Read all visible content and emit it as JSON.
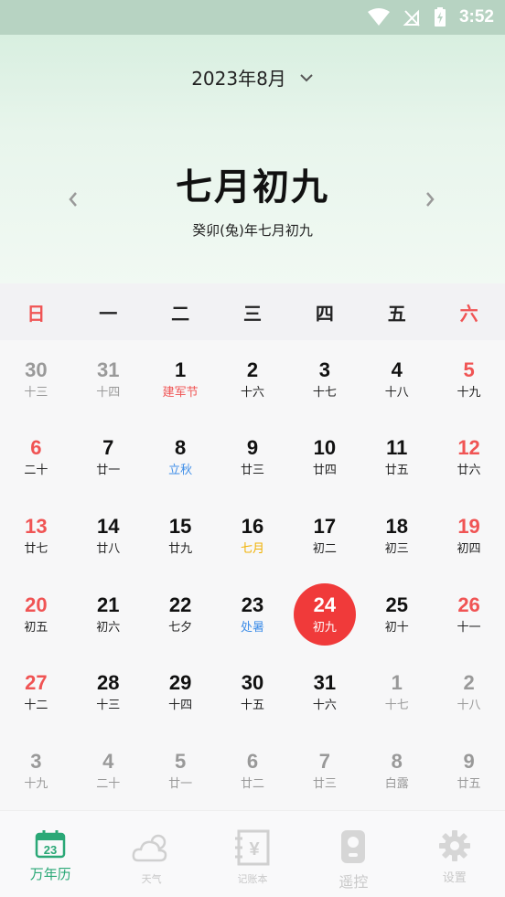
{
  "status_bar": {
    "time": "3:52"
  },
  "header": {
    "month_label": "2023年8月",
    "lunar_date": "七月初九",
    "lunar_full": "癸卯(兔)年七月初九"
  },
  "weekdays": [
    "日",
    "一",
    "二",
    "三",
    "四",
    "五",
    "六"
  ],
  "calendar": {
    "days": [
      {
        "num": "30",
        "sub": "十三",
        "other": true
      },
      {
        "num": "31",
        "sub": "十四",
        "other": true
      },
      {
        "num": "1",
        "sub": "建军节",
        "tag": "red"
      },
      {
        "num": "2",
        "sub": "十六"
      },
      {
        "num": "3",
        "sub": "十七"
      },
      {
        "num": "4",
        "sub": "十八"
      },
      {
        "num": "5",
        "sub": "十九"
      },
      {
        "num": "6",
        "sub": "二十"
      },
      {
        "num": "7",
        "sub": "廿一"
      },
      {
        "num": "8",
        "sub": "立秋",
        "tag": "blue"
      },
      {
        "num": "9",
        "sub": "廿三"
      },
      {
        "num": "10",
        "sub": "廿四"
      },
      {
        "num": "11",
        "sub": "廿五"
      },
      {
        "num": "12",
        "sub": "廿六"
      },
      {
        "num": "13",
        "sub": "廿七"
      },
      {
        "num": "14",
        "sub": "廿八"
      },
      {
        "num": "15",
        "sub": "廿九"
      },
      {
        "num": "16",
        "sub": "七月",
        "tag": "gold"
      },
      {
        "num": "17",
        "sub": "初二"
      },
      {
        "num": "18",
        "sub": "初三"
      },
      {
        "num": "19",
        "sub": "初四"
      },
      {
        "num": "20",
        "sub": "初五"
      },
      {
        "num": "21",
        "sub": "初六"
      },
      {
        "num": "22",
        "sub": "七夕"
      },
      {
        "num": "23",
        "sub": "处暑",
        "tag": "blue"
      },
      {
        "num": "24",
        "sub": "初九",
        "today": true
      },
      {
        "num": "25",
        "sub": "初十"
      },
      {
        "num": "26",
        "sub": "十一"
      },
      {
        "num": "27",
        "sub": "十二"
      },
      {
        "num": "28",
        "sub": "十三"
      },
      {
        "num": "29",
        "sub": "十四"
      },
      {
        "num": "30",
        "sub": "十五"
      },
      {
        "num": "31",
        "sub": "十六"
      },
      {
        "num": "1",
        "sub": "十七",
        "other": true
      },
      {
        "num": "2",
        "sub": "十八",
        "other": true
      },
      {
        "num": "3",
        "sub": "十九",
        "other": true
      },
      {
        "num": "4",
        "sub": "二十",
        "other": true
      },
      {
        "num": "5",
        "sub": "廿一",
        "other": true
      },
      {
        "num": "6",
        "sub": "廿二",
        "other": true
      },
      {
        "num": "7",
        "sub": "廿三",
        "other": true
      },
      {
        "num": "8",
        "sub": "白露",
        "other": true
      },
      {
        "num": "9",
        "sub": "廿五",
        "other": true
      }
    ]
  },
  "tabs": [
    {
      "label": "万年历",
      "icon": "calendar-icon",
      "active": true,
      "icon_text": "23"
    },
    {
      "label": "天气",
      "icon": "weather-icon"
    },
    {
      "label": "记账本",
      "icon": "ledger-icon",
      "icon_text": "¥"
    },
    {
      "label": "遥控",
      "icon": "remote-icon"
    },
    {
      "label": "设置",
      "icon": "gear-icon"
    }
  ],
  "colors": {
    "accent": "#2aa876",
    "weekend": "#f05454",
    "today": "#f03a3a",
    "term": "#3f8ee8",
    "month_start": "#f0b000"
  }
}
